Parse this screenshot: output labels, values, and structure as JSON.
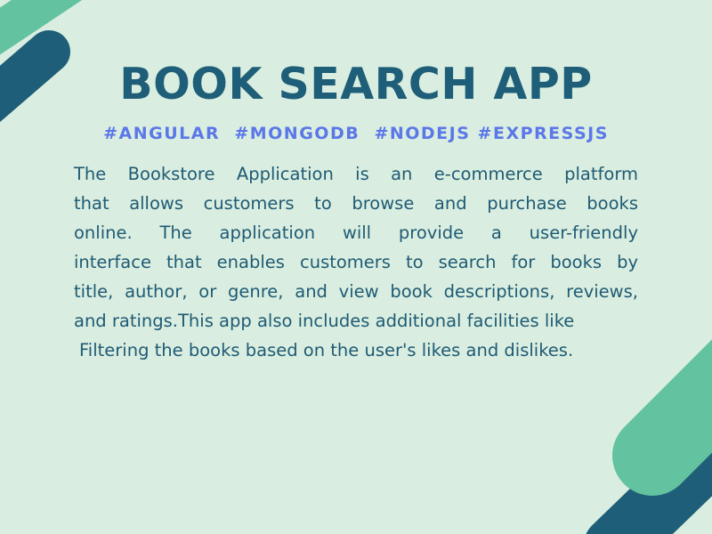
{
  "title": "BOOK SEARCH APP",
  "tags": [
    "#ANGULAR",
    "#MONGODB",
    "#NODEJS",
    "#EXPRESSJS"
  ],
  "description_lines": [
    "The Bookstore Application is an e-commerce platform",
    "that allows customers to browse and purchase books",
    "online. The application will provide a user-friendly",
    "interface that enables customers to search for books by",
    "title, author, or genre, and view book descriptions, reviews,",
    "and ratings.This app also includes additional facilities like",
    "Filtering the books based on the user's likes and dislikes."
  ],
  "colors": {
    "background": "#d9eee0",
    "title": "#1e5e78",
    "tags": "#5b77e8",
    "body_text": "#1f5a74",
    "stripe_dark": "#1f5e78",
    "stripe_light": "#63c2a0"
  }
}
